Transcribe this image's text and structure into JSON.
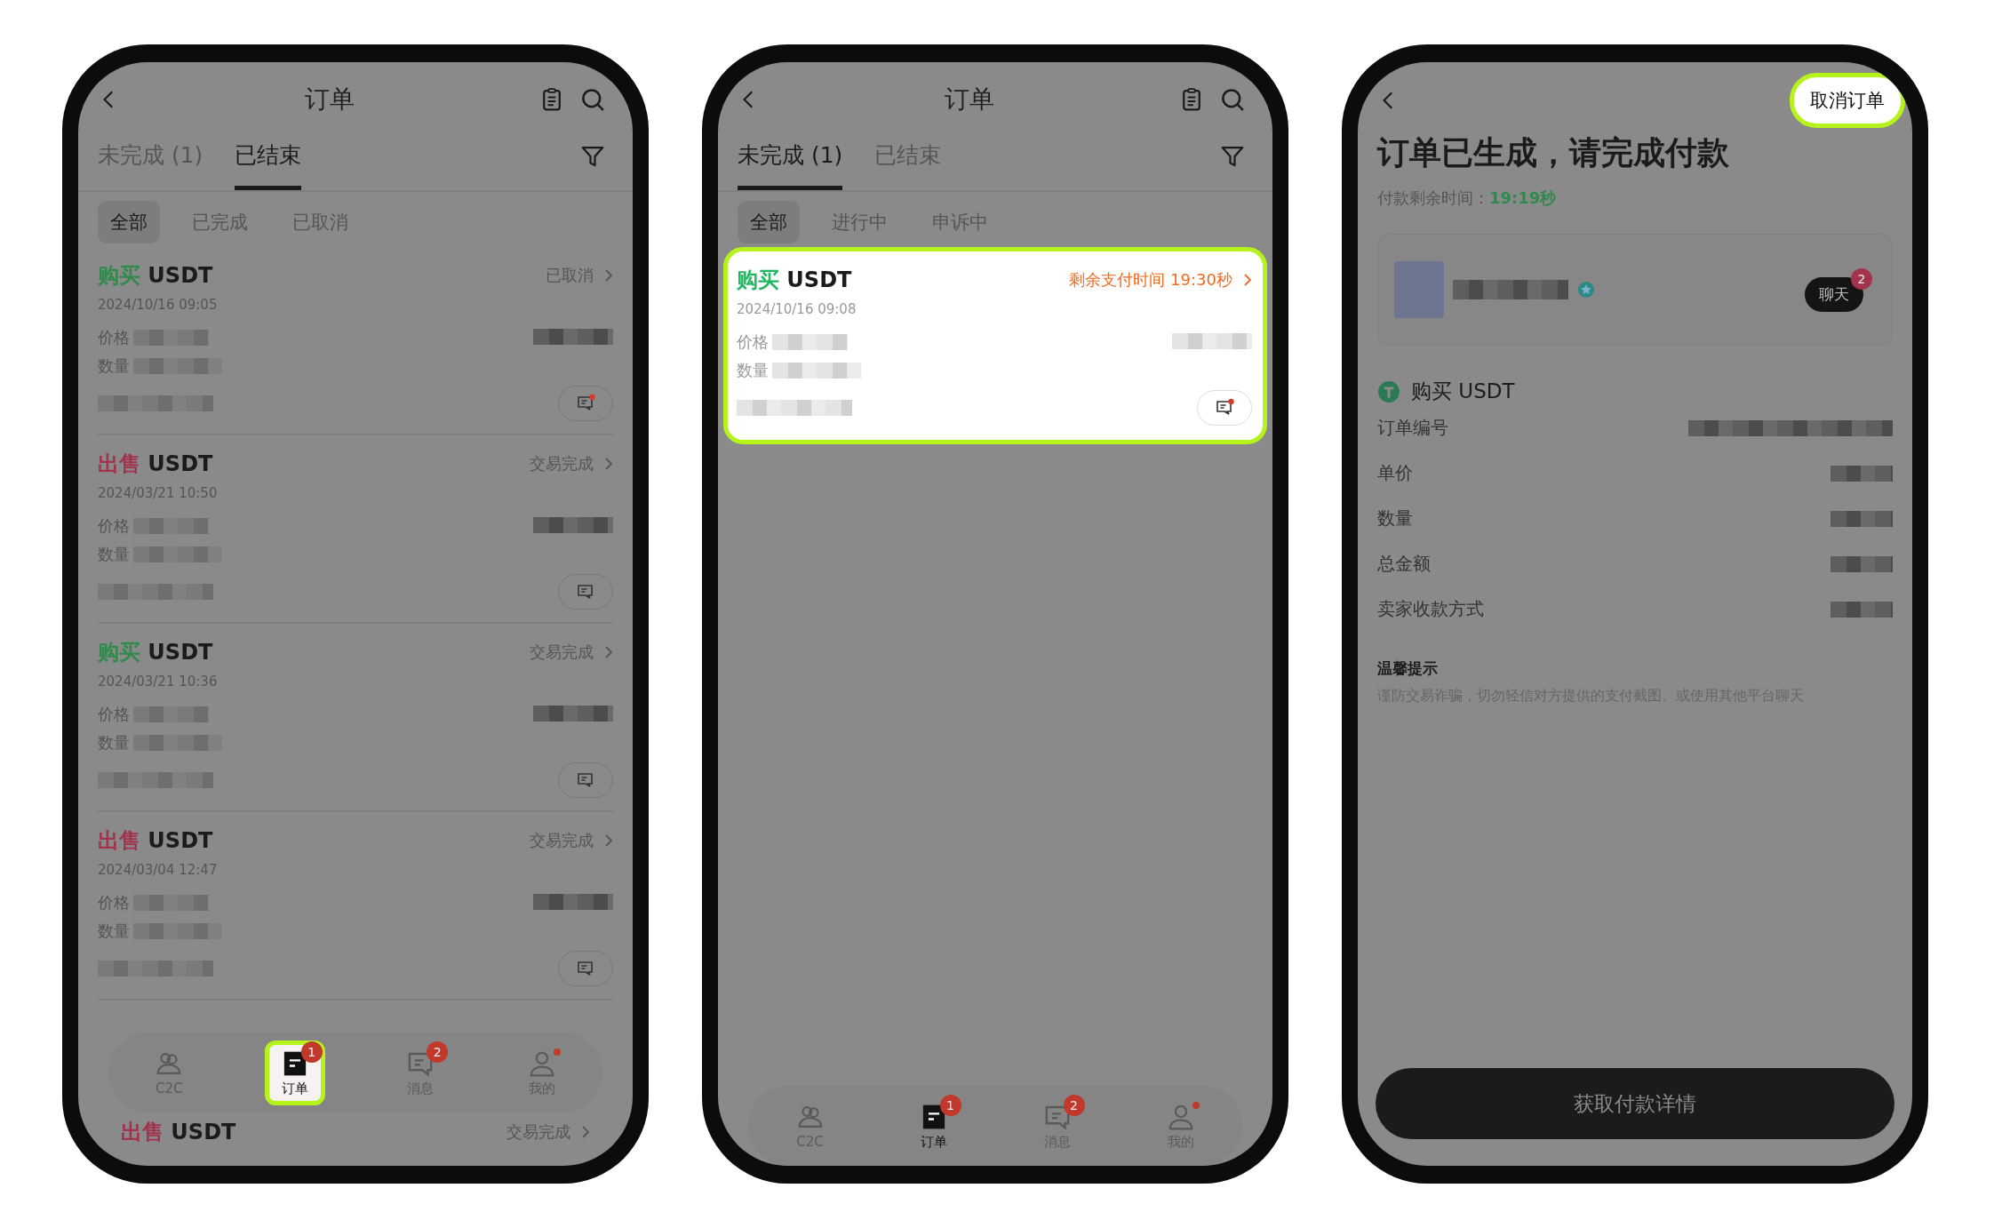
{
  "phones": [
    {
      "kind": "order_list",
      "title": "订单",
      "tabs": [
        {
          "label": "未完成 (1)",
          "selected": false
        },
        {
          "label": "已结束",
          "selected": true
        }
      ],
      "filters": [
        {
          "label": "全部",
          "selected": true
        },
        {
          "label": "已完成",
          "selected": false
        },
        {
          "label": "已取消",
          "selected": false
        }
      ],
      "orders": [
        {
          "color": "#2f8a4c",
          "side_label": "购买",
          "coin": "USDT",
          "status": "已取消",
          "urgent": false,
          "date": "2024/10/16 09:05",
          "price_label": "价格",
          "qty_label": "数量",
          "unread": true,
          "highlighted": false
        },
        {
          "color": "#a3324c",
          "side_label": "出售",
          "coin": "USDT",
          "status": "交易完成",
          "urgent": false,
          "date": "2024/03/21 10:50",
          "price_label": "价格",
          "qty_label": "数量",
          "unread": false,
          "highlighted": false
        },
        {
          "color": "#2f8a4c",
          "side_label": "购买",
          "coin": "USDT",
          "status": "交易完成",
          "urgent": false,
          "date": "2024/03/21 10:36",
          "price_label": "价格",
          "qty_label": "数量",
          "unread": false,
          "highlighted": false
        },
        {
          "color": "#a3324c",
          "side_label": "出售",
          "coin": "USDT",
          "status": "交易完成",
          "urgent": false,
          "date": "2024/03/04 12:47",
          "price_label": "价格",
          "qty_label": "数量",
          "unread": false,
          "highlighted": false
        },
        {
          "color": "#a3324c",
          "side_label": "出售",
          "coin": "USDT",
          "status": "交易完成",
          "urgent": false,
          "highlighted": false
        }
      ],
      "nav": [
        {
          "label": "C2C",
          "selected": false,
          "highlighted": false
        },
        {
          "label": "订单",
          "badge": "1",
          "selected": true,
          "highlighted": true
        },
        {
          "label": "消息",
          "badge": "2",
          "selected": false,
          "highlighted": false
        },
        {
          "label": "我的",
          "dot": true,
          "selected": false,
          "highlighted": false
        }
      ]
    },
    {
      "kind": "order_list",
      "title": "订单",
      "tabs": [
        {
          "label": "未完成 (1)",
          "selected": true
        },
        {
          "label": "已结束",
          "selected": false
        }
      ],
      "filters": [
        {
          "label": "全部",
          "selected": true
        },
        {
          "label": "进行中",
          "selected": false
        },
        {
          "label": "申诉中",
          "selected": false
        }
      ],
      "orders": [
        {
          "color": "#22b862",
          "side_label": "购买",
          "coin": "USDT",
          "status": "剩余支付时间 19:30秒",
          "urgent": true,
          "date": "2024/10/16 09:08",
          "price_label": "价格",
          "qty_label": "数量",
          "unread": true,
          "highlighted": true
        }
      ],
      "nav": [
        {
          "label": "C2C",
          "selected": false,
          "highlighted": false
        },
        {
          "label": "订单",
          "badge": "1",
          "selected": true,
          "highlighted": false
        },
        {
          "label": "消息",
          "badge": "2",
          "selected": false,
          "highlighted": false
        },
        {
          "label": "我的",
          "dot": true,
          "selected": false,
          "highlighted": false
        }
      ]
    },
    {
      "kind": "order_detail",
      "action": {
        "label": "取消订单",
        "highlighted": true
      },
      "heading": "订单已生成，请完成付款",
      "countdown_label": "付款剩余时间：",
      "countdown": "19:19秒",
      "seller": {
        "verified": true,
        "chat_label": "聊天",
        "chat_badge": "2"
      },
      "product": "购买 USDT",
      "fields": [
        {
          "label": "订单编号"
        },
        {
          "label": "单价"
        },
        {
          "label": "数量"
        },
        {
          "label": "总金额"
        },
        {
          "label": "卖家收款方式"
        }
      ],
      "tip_title": "温馨提示",
      "tip_text": "谨防交易诈骗，切勿轻信对方提供的支付截图、或使用其他平台聊天",
      "button": "获取付款详情"
    }
  ]
}
